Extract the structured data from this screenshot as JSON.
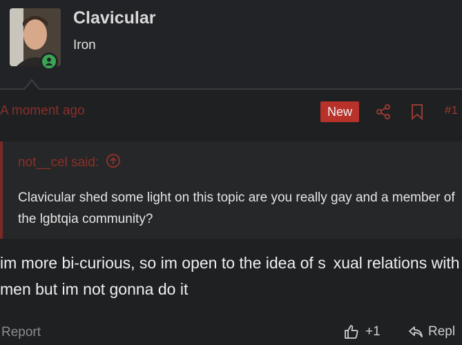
{
  "user": {
    "name": "Clavicular",
    "rank": "Iron",
    "online": true
  },
  "post": {
    "timestamp": "A moment ago",
    "new_badge": "New",
    "post_number": "#1",
    "quote": {
      "author": "not__cel said:",
      "text": "Clavicular shed some light on this topic are you really gay and a member of the lgbtqia community?"
    },
    "body": "im more bi-curious, so im open to the idea of s  xual relations with men but im not gonna do it"
  },
  "footer": {
    "report_label": "Report",
    "like_label": "+1",
    "reply_label": "Repl"
  },
  "colors": {
    "accent": "#b8322a",
    "muted_red": "#8a2f2a",
    "online": "#3aa655",
    "background": "#1f2022"
  }
}
